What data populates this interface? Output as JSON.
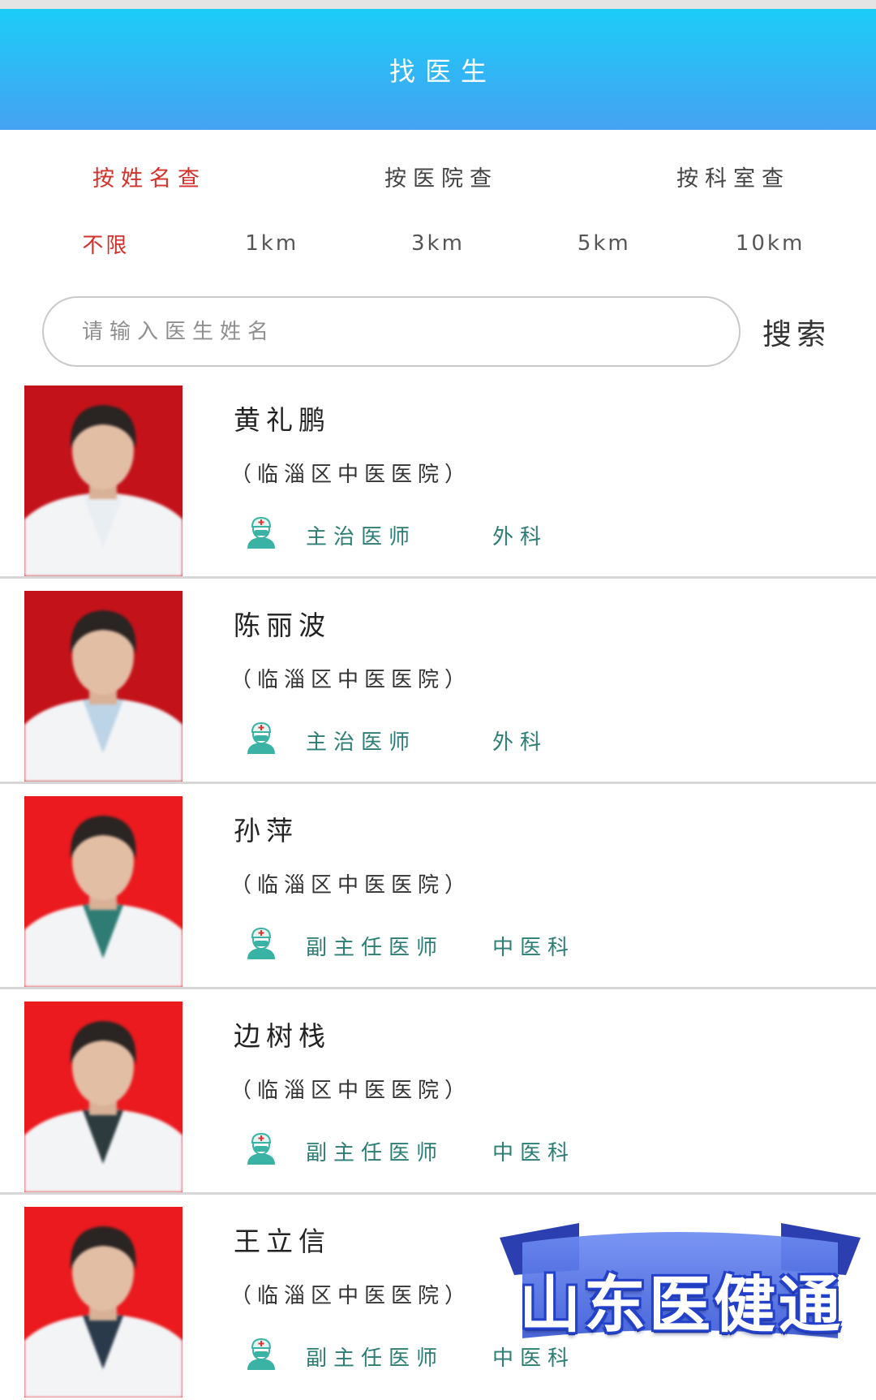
{
  "header": {
    "title": "找医生"
  },
  "search_modes": [
    {
      "label": "按姓名查",
      "active": true
    },
    {
      "label": "按医院查",
      "active": false
    },
    {
      "label": "按科室查",
      "active": false
    }
  ],
  "distance_filters": [
    {
      "label": "不限",
      "active": true
    },
    {
      "label": "1km",
      "active": false
    },
    {
      "label": "3km",
      "active": false
    },
    {
      "label": "5km",
      "active": false
    },
    {
      "label": "10km",
      "active": false
    }
  ],
  "search": {
    "placeholder": "请输入医生姓名",
    "button_label": "搜索"
  },
  "doctors": [
    {
      "name": "黄礼鹏",
      "hospital": "（临淄区中医医院）",
      "title": "主治医师",
      "department": "外科",
      "title_icon": "doctor-icon",
      "photo": {
        "background": "#c4121a",
        "shirt": "#e9eef3"
      }
    },
    {
      "name": "陈丽波",
      "hospital": "（临淄区中医医院）",
      "title": "主治医师",
      "department": "外科",
      "title_icon": "doctor-icon",
      "photo": {
        "background": "#c4121a",
        "shirt": "#bcd4e6"
      }
    },
    {
      "name": "孙萍",
      "hospital": "（临淄区中医医院）",
      "title": "副主任医师",
      "department": "中医科",
      "title_icon": "doctor-icon",
      "photo": {
        "background": "#ea1a1f",
        "shirt": "#2f7c74"
      }
    },
    {
      "name": "边树栈",
      "hospital": "（临淄区中医医院）",
      "title": "副主任医师",
      "department": "中医科",
      "title_icon": "doctor-icon",
      "photo": {
        "background": "#ea1a1f",
        "shirt": "#2d3b3f"
      }
    },
    {
      "name": "王立信",
      "hospital": "（临淄区中医医院）",
      "title": "副主任医师",
      "department": "中医科",
      "title_icon": "doctor-icon",
      "photo": {
        "background": "#ea1a1f",
        "shirt": "#2b3a4a"
      }
    }
  ],
  "watermark": {
    "text": "山东医健通"
  },
  "colors": {
    "accent": "#d2322b",
    "header_top": "#1ccdf8",
    "header_bottom": "#45a2f2",
    "info_text": "#2c7d74",
    "icon": "#3bb3a4"
  }
}
